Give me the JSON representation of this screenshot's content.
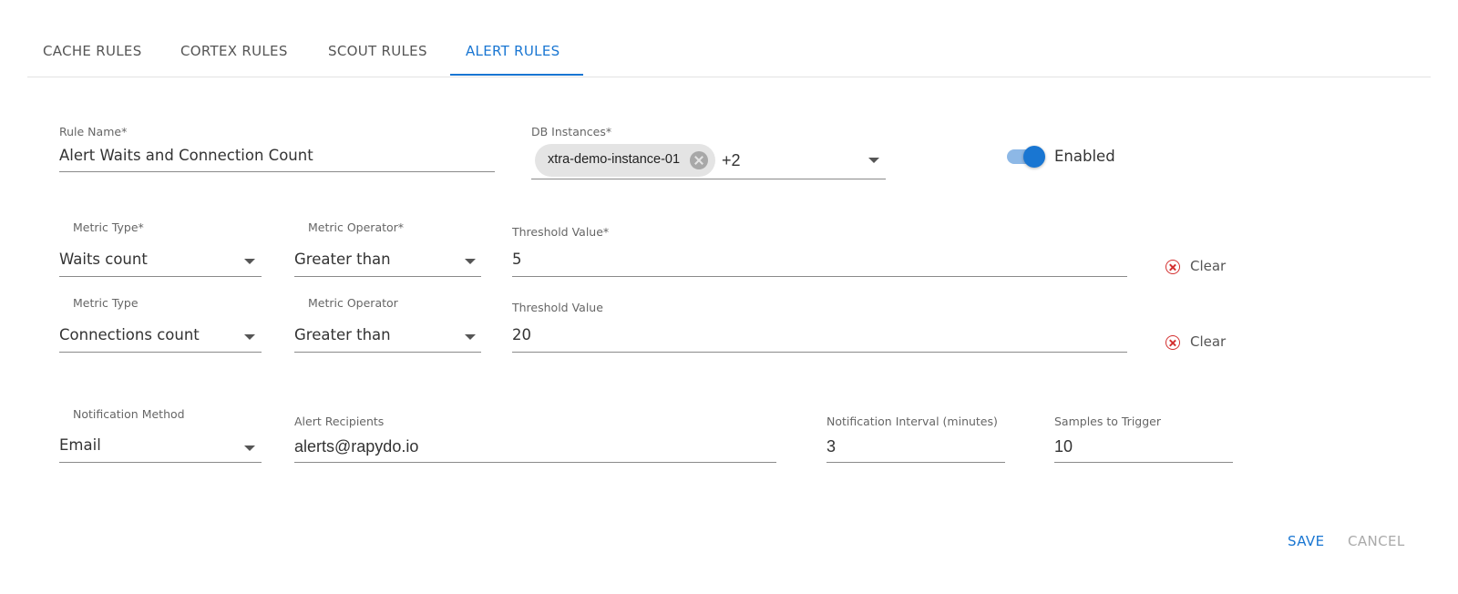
{
  "tabs": [
    {
      "label": "CACHE RULES"
    },
    {
      "label": "CORTEX RULES"
    },
    {
      "label": "SCOUT RULES"
    },
    {
      "label": "ALERT RULES"
    }
  ],
  "active_tab": "ALERT RULES",
  "rule_name": {
    "label": "Rule Name",
    "required_mark": "*",
    "value": "Alert Waits and Connection Count"
  },
  "db_instances": {
    "label": "DB Instances",
    "required_mark": "*",
    "chip": "xtra-demo-instance-01",
    "more": "+2"
  },
  "enabled": {
    "label": "Enabled",
    "on": true
  },
  "conditions": [
    {
      "metric_type": {
        "label": "Metric Type*",
        "value": "Waits count"
      },
      "metric_operator": {
        "label": "Metric Operator*",
        "value": "Greater than"
      },
      "threshold": {
        "label": "Threshold Value",
        "required_mark": "*",
        "value": "5"
      },
      "clear_label": "Clear"
    },
    {
      "metric_type": {
        "label": "Metric Type",
        "value": "Connections count"
      },
      "metric_operator": {
        "label": "Metric Operator",
        "value": "Greater than"
      },
      "threshold": {
        "label": "Threshold Value",
        "required_mark": "",
        "value": "20"
      },
      "clear_label": "Clear"
    }
  ],
  "notification": {
    "method": {
      "label": "Notification Method",
      "value": "Email"
    },
    "recipients": {
      "label": "Alert Recipients",
      "value": "alerts@rapydo.io"
    },
    "interval": {
      "label": "Notification Interval (minutes)",
      "value": "3"
    },
    "samples": {
      "label": "Samples to Trigger",
      "value": "10"
    }
  },
  "actions": {
    "save": "SAVE",
    "cancel": "CANCEL"
  },
  "colors": {
    "accent": "#1976d2",
    "danger": "#d32f2f",
    "muted": "#aaaaaa"
  }
}
